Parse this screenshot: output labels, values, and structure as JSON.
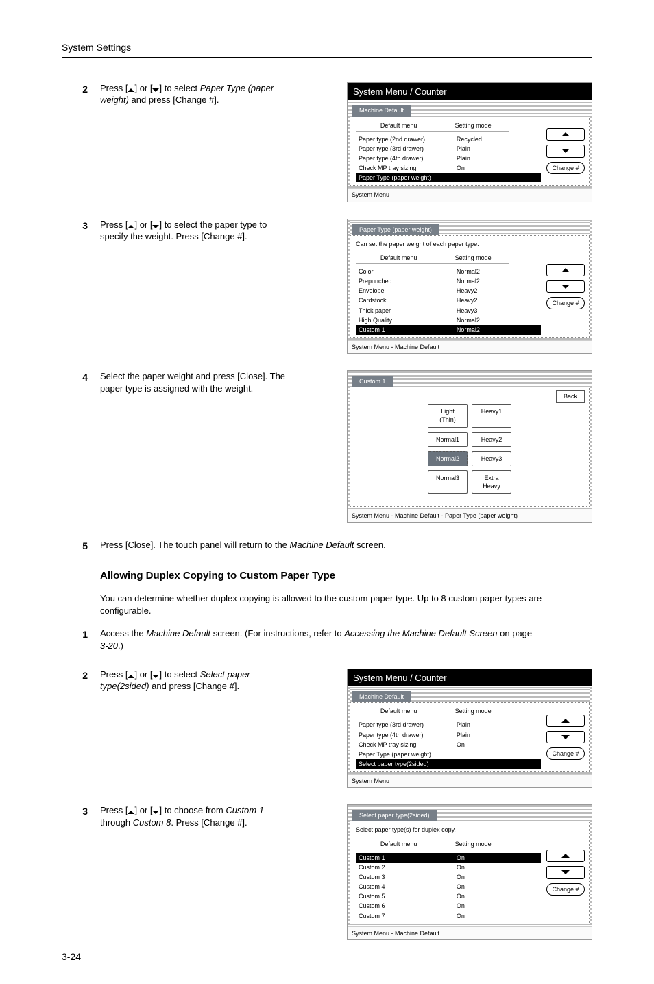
{
  "page": {
    "running_head": "System Settings",
    "page_number": "3-24"
  },
  "step2": {
    "num": "2",
    "text_a": "Press [",
    "text_b": "] or [",
    "text_c": "] to select ",
    "ital": "Paper Type (paper weight)",
    "text_d": " and press [Change #].",
    "panel": {
      "title": "System Menu / Counter",
      "tab": "Machine Default",
      "legend_left": "Default menu",
      "legend_right": "Setting mode",
      "rows": [
        {
          "name": "Paper type (2nd drawer)",
          "mode": "Recycled",
          "sel": false
        },
        {
          "name": "Paper type (3rd drawer)",
          "mode": "Plain",
          "sel": false
        },
        {
          "name": "Paper type (4th drawer)",
          "mode": "Plain",
          "sel": false
        },
        {
          "name": "Check MP tray sizing",
          "mode": "On",
          "sel": false
        },
        {
          "name": "Paper Type (paper weight)",
          "mode": "",
          "sel": true
        }
      ],
      "change": "Change #",
      "crumb": "System Menu"
    }
  },
  "step3": {
    "num": "3",
    "text_a": "Press [",
    "text_b": "] or [",
    "text_c": "] to select the paper type to specify the weight. Press [Change #].",
    "panel": {
      "title_tab": "Paper Type (paper weight)",
      "helper": "Can set the paper weight of each paper type.",
      "legend_left": "Default menu",
      "legend_right": "Setting mode",
      "rows": [
        {
          "name": "Color",
          "mode": "Normal2",
          "sel": false
        },
        {
          "name": "Prepunched",
          "mode": "Normal2",
          "sel": false
        },
        {
          "name": "Envelope",
          "mode": "Heavy2",
          "sel": false
        },
        {
          "name": "Cardstock",
          "mode": "Heavy2",
          "sel": false
        },
        {
          "name": "Thick paper",
          "mode": "Heavy3",
          "sel": false
        },
        {
          "name": "High Quality",
          "mode": "Normal2",
          "sel": false
        },
        {
          "name": "Custom 1",
          "mode": "Normal2",
          "sel": true
        }
      ],
      "change": "Change #",
      "crumb": "System Menu     -   Machine Default"
    }
  },
  "step4": {
    "num": "4",
    "text": "Select the paper weight and press [Close]. The paper type is assigned with the weight.",
    "panel": {
      "title_tab": "Custom 1",
      "back": "Back",
      "cells": [
        {
          "label": "Light\n(Thin)",
          "sel": false
        },
        {
          "label": "Heavy1",
          "sel": false
        },
        {
          "label": "Normal1",
          "sel": false
        },
        {
          "label": "Heavy2",
          "sel": false
        },
        {
          "label": "Normal2",
          "sel": true
        },
        {
          "label": "Heavy3",
          "sel": false
        },
        {
          "label": "Normal3",
          "sel": false
        },
        {
          "label": "Extra\nHeavy",
          "sel": false
        }
      ],
      "crumb": "System Menu       -   Machine Default   -   Paper Type (paper weight)"
    }
  },
  "step5": {
    "num": "5",
    "text_a": "Press [Close]. The touch panel will return to the ",
    "ital": "Machine Default",
    "text_b": " screen."
  },
  "sectionB": {
    "heading": "Allowing Duplex Copying to Custom Paper Type",
    "intro": "You can determine whether duplex copying is allowed to the custom paper type. Up to 8 custom paper types are configurable."
  },
  "step1b": {
    "num": "1",
    "text_a": "Access the ",
    "ital1": "Machine Default",
    "text_b": " screen. (For instructions, refer to ",
    "ital2": "Accessing the Machine Default Screen",
    "text_c": " on page ",
    "ital3": "3-20",
    "text_d": ".)"
  },
  "step2b": {
    "num": "2",
    "text_a": "Press [",
    "text_b": "] or [",
    "text_c": "] to select ",
    "ital": "Select paper type(2sided)",
    "text_d": " and press [Change #].",
    "panel": {
      "title": "System Menu / Counter",
      "tab": "Machine Default",
      "legend_left": "Default menu",
      "legend_right": "Setting mode",
      "rows": [
        {
          "name": "Paper type (3rd drawer)",
          "mode": "Plain",
          "sel": false
        },
        {
          "name": "Paper type (4th drawer)",
          "mode": "Plain",
          "sel": false
        },
        {
          "name": "Check MP tray sizing",
          "mode": "On",
          "sel": false
        },
        {
          "name": "Paper Type (paper weight)",
          "mode": "",
          "sel": false
        },
        {
          "name": "Select paper type(2sided)",
          "mode": "",
          "sel": true
        }
      ],
      "change": "Change #",
      "crumb": "System Menu"
    }
  },
  "step3b": {
    "num": "3",
    "text_a": "Press [",
    "text_b": "] or [",
    "text_c": "] to choose from ",
    "ital1": "Custom 1",
    "text_d": " through ",
    "ital2": "Custom 8",
    "text_e": ". Press [Change #].",
    "panel": {
      "title_tab": "Select paper type(2sided)",
      "helper": "Select paper type(s) for duplex copy.",
      "legend_left": "Default menu",
      "legend_right": "Setting mode",
      "rows": [
        {
          "name": "Custom 1",
          "mode": "On",
          "sel": true
        },
        {
          "name": "Custom 2",
          "mode": "On",
          "sel": false
        },
        {
          "name": "Custom 3",
          "mode": "On",
          "sel": false
        },
        {
          "name": "Custom 4",
          "mode": "On",
          "sel": false
        },
        {
          "name": "Custom 5",
          "mode": "On",
          "sel": false
        },
        {
          "name": "Custom 6",
          "mode": "On",
          "sel": false
        },
        {
          "name": "Custom 7",
          "mode": "On",
          "sel": false
        }
      ],
      "change": "Change #",
      "crumb": "System Menu      -   Machine Default"
    }
  }
}
